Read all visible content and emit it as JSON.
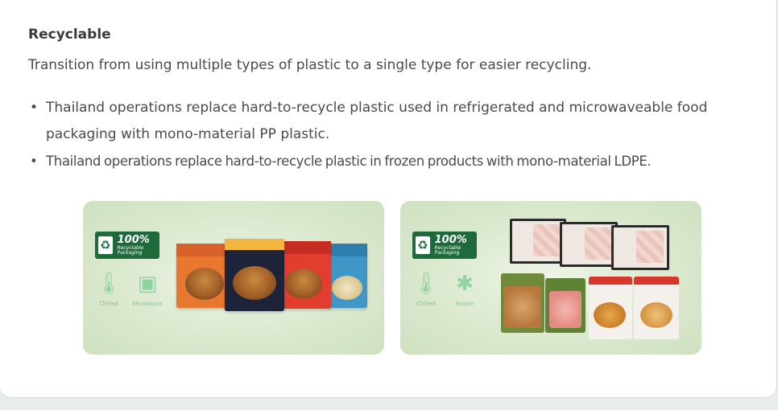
{
  "section": {
    "title": "Recyclable",
    "intro": "Transition from using multiple types of plastic to a single type for easier recycling.",
    "bullets": [
      "Thailand operations replace hard-to-recycle plastic used in refrigerated and microwaveable food packaging with mono-material PP plastic.",
      "Thailand operations replace hard-to-recycle plastic in frozen products with mono-material LDPE."
    ]
  },
  "panels": {
    "left": {
      "badge_percent": "100%",
      "badge_sub": "Recyclable Packaging",
      "icon_labels": [
        "Chilled",
        "Microwave"
      ],
      "icons": [
        "thermometer-icon",
        "microwave-icon"
      ]
    },
    "right": {
      "badge_percent": "100%",
      "badge_sub": "Recyclable Packaging",
      "icon_labels": [
        "Chilled",
        "Frozen"
      ],
      "icons": [
        "thermometer-icon",
        "snowflake-icon"
      ]
    }
  },
  "colors": {
    "badge_green": "#1f6a3a",
    "icon_mint": "#8fd3a0",
    "panel_bg": "#dbe9cf"
  }
}
